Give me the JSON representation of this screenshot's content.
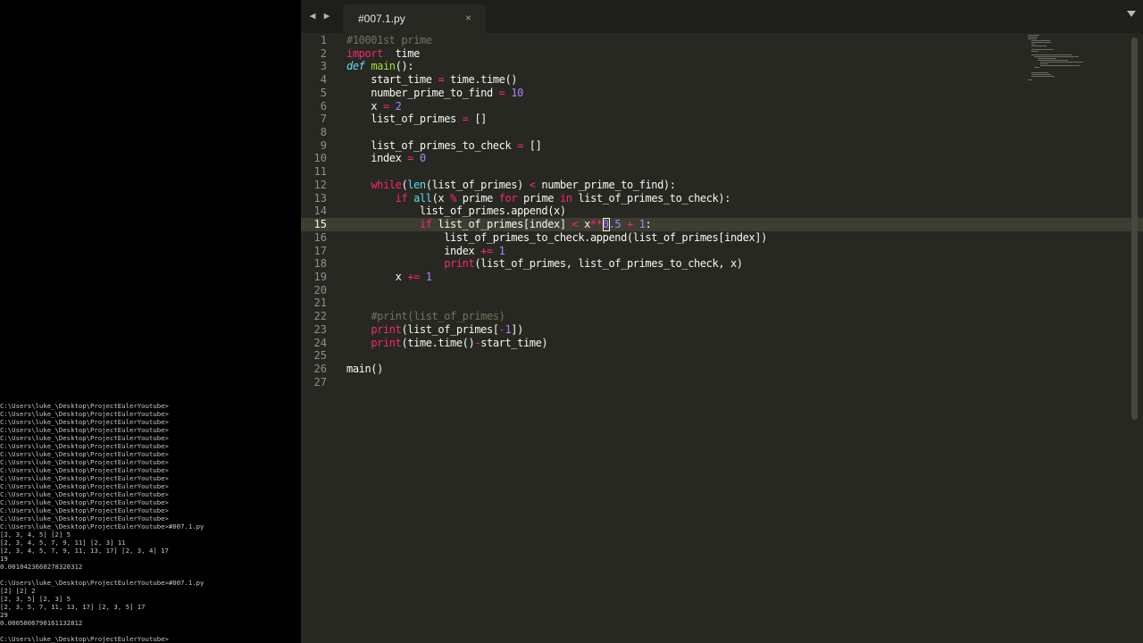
{
  "console": {
    "lines": [
      "C:\\Users\\luke_\\Desktop\\ProjectEulerYoutube>",
      "C:\\Users\\luke_\\Desktop\\ProjectEulerYoutube>",
      "C:\\Users\\luke_\\Desktop\\ProjectEulerYoutube>",
      "C:\\Users\\luke_\\Desktop\\ProjectEulerYoutube>",
      "C:\\Users\\luke_\\Desktop\\ProjectEulerYoutube>",
      "C:\\Users\\luke_\\Desktop\\ProjectEulerYoutube>",
      "C:\\Users\\luke_\\Desktop\\ProjectEulerYoutube>",
      "C:\\Users\\luke_\\Desktop\\ProjectEulerYoutube>",
      "C:\\Users\\luke_\\Desktop\\ProjectEulerYoutube>",
      "C:\\Users\\luke_\\Desktop\\ProjectEulerYoutube>",
      "C:\\Users\\luke_\\Desktop\\ProjectEulerYoutube>",
      "C:\\Users\\luke_\\Desktop\\ProjectEulerYoutube>",
      "C:\\Users\\luke_\\Desktop\\ProjectEulerYoutube>",
      "C:\\Users\\luke_\\Desktop\\ProjectEulerYoutube>",
      "C:\\Users\\luke_\\Desktop\\ProjectEulerYoutube>",
      "C:\\Users\\luke_\\Desktop\\ProjectEulerYoutube>#007.1.py",
      "[2, 3, 4, 5] [2] 5",
      "[2, 3, 4, 5, 7, 9, 11] [2, 3] 11",
      "[2, 3, 4, 5, 7, 9, 11, 13, 17] [2, 3, 4] 17",
      "19",
      "0.0010423660278320312",
      "",
      "C:\\Users\\luke_\\Desktop\\ProjectEulerYoutube>#007.1.py",
      "[2] [2] 2",
      "[2, 3, 5] [2, 3] 5",
      "[2, 3, 5, 7, 11, 13, 17] [2, 3, 5] 17",
      "29",
      "0.0005006790161132812",
      "",
      "C:\\Users\\luke_\\Desktop\\ProjectEulerYoutube>"
    ]
  },
  "editor": {
    "tab": {
      "label": "#007.1.py",
      "close_glyph": "×"
    },
    "nav": {
      "back_glyph": "◀",
      "forward_glyph": "▶"
    },
    "current_line": 15,
    "code_lines": [
      [
        [
          "c-comment",
          "#10001st prime"
        ]
      ],
      [
        [
          "c-kw",
          "import"
        ],
        [
          "",
          "  time"
        ]
      ],
      [
        [
          "c-def",
          "def"
        ],
        [
          "",
          " "
        ],
        [
          "c-fn",
          "main"
        ],
        [
          "",
          "():"
        ]
      ],
      [
        [
          "",
          "    start_time "
        ],
        [
          "c-op",
          "="
        ],
        [
          "",
          " time.time()"
        ]
      ],
      [
        [
          "",
          "    number_prime_to_find "
        ],
        [
          "c-op",
          "="
        ],
        [
          "",
          " "
        ],
        [
          "c-num",
          "10"
        ]
      ],
      [
        [
          "",
          "    x "
        ],
        [
          "c-op",
          "="
        ],
        [
          "",
          " "
        ],
        [
          "c-num",
          "2"
        ]
      ],
      [
        [
          "",
          "    list_of_primes "
        ],
        [
          "c-op",
          "="
        ],
        [
          "",
          " []"
        ]
      ],
      [
        [
          "",
          ""
        ]
      ],
      [
        [
          "",
          "    list_of_primes_to_check "
        ],
        [
          "c-op",
          "="
        ],
        [
          "",
          " []"
        ]
      ],
      [
        [
          "",
          "    index "
        ],
        [
          "c-op",
          "="
        ],
        [
          "",
          " "
        ],
        [
          "c-num",
          "0"
        ]
      ],
      [
        [
          "",
          ""
        ]
      ],
      [
        [
          "",
          "    "
        ],
        [
          "c-kw",
          "while"
        ],
        [
          "",
          "("
        ],
        [
          "c-bi",
          "len"
        ],
        [
          "",
          "(list_of_primes) "
        ],
        [
          "c-op",
          "<"
        ],
        [
          "",
          " number_prime_to_find):"
        ]
      ],
      [
        [
          "",
          "        "
        ],
        [
          "c-kw",
          "if"
        ],
        [
          "",
          " "
        ],
        [
          "c-bi",
          "all"
        ],
        [
          "",
          "(x "
        ],
        [
          "c-op",
          "%"
        ],
        [
          "",
          " prime "
        ],
        [
          "c-kw",
          "for"
        ],
        [
          "",
          " prime "
        ],
        [
          "c-kw",
          "in"
        ],
        [
          "",
          " list_of_primes_to_check):"
        ]
      ],
      [
        [
          "",
          "            list_of_primes.append(x)"
        ]
      ],
      [
        [
          "",
          "            "
        ],
        [
          "c-kw",
          "if"
        ],
        [
          "",
          " list_of_primes[index] "
        ],
        [
          "c-op",
          "<"
        ],
        [
          "",
          " x"
        ],
        [
          "c-op",
          "**"
        ],
        [
          "c-num",
          "0.5"
        ],
        [
          "",
          " "
        ],
        [
          "c-op",
          "+"
        ],
        [
          "",
          " "
        ],
        [
          "c-num",
          "1"
        ],
        [
          "",
          ":"
        ]
      ],
      [
        [
          "",
          "                list_of_primes_to_check.append(list_of_primes[index])"
        ]
      ],
      [
        [
          "",
          "                index "
        ],
        [
          "c-op",
          "+="
        ],
        [
          "",
          " "
        ],
        [
          "c-num",
          "1"
        ]
      ],
      [
        [
          "",
          "                "
        ],
        [
          "c-kw",
          "print"
        ],
        [
          "",
          "(list_of_primes, list_of_primes_to_check, x)"
        ]
      ],
      [
        [
          "",
          "        x "
        ],
        [
          "c-op",
          "+="
        ],
        [
          "",
          " "
        ],
        [
          "c-num",
          "1"
        ]
      ],
      [
        [
          "",
          ""
        ]
      ],
      [
        [
          "",
          ""
        ]
      ],
      [
        [
          "",
          "    "
        ],
        [
          "c-comment",
          "#print(list_of_primes)"
        ]
      ],
      [
        [
          "",
          "    "
        ],
        [
          "c-kw",
          "print"
        ],
        [
          "",
          "(list_of_primes["
        ],
        [
          "c-op",
          "-"
        ],
        [
          "c-num",
          "1"
        ],
        [
          "",
          "])"
        ]
      ],
      [
        [
          "",
          "    "
        ],
        [
          "c-kw",
          "print"
        ],
        [
          "",
          "(time.time()"
        ],
        [
          "c-op",
          "-"
        ],
        [
          "",
          "start_time)"
        ]
      ],
      [
        [
          "",
          ""
        ]
      ],
      [
        [
          "",
          "main()"
        ]
      ],
      [
        [
          "",
          ""
        ]
      ]
    ]
  },
  "colors": {
    "editor_bg": "#272822",
    "tabbar_bg": "#1e1f1c",
    "keyword": "#f92672",
    "function": "#a6e22e",
    "number": "#ae81ff",
    "comment": "#75715e",
    "builtin": "#66d9ef"
  }
}
